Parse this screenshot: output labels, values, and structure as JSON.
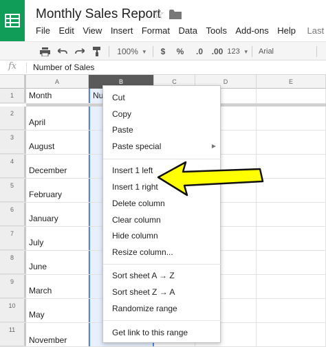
{
  "doc": {
    "title": "Monthly Sales Report"
  },
  "menu": {
    "items": [
      "File",
      "Edit",
      "View",
      "Insert",
      "Format",
      "Data",
      "Tools",
      "Add-ons",
      "Help"
    ],
    "last_edit": "Last edit"
  },
  "toolbar": {
    "zoom": "100%",
    "currency": "$",
    "percent": "%",
    "decrease_decimals": ".0",
    "increase_decimals": ".00",
    "more_formats": "123",
    "font": "Arial"
  },
  "formula_bar": {
    "fx": "fx",
    "value": "Number of Sales"
  },
  "columns": [
    "A",
    "B",
    "C",
    "D",
    "E"
  ],
  "rows": [
    {
      "num": "1",
      "a": "Month",
      "b": "Nu"
    },
    {
      "num": "2",
      "a": "April",
      "b": ""
    },
    {
      "num": "3",
      "a": "August",
      "b": ""
    },
    {
      "num": "4",
      "a": "December",
      "b": ""
    },
    {
      "num": "5",
      "a": "February",
      "b": ""
    },
    {
      "num": "6",
      "a": "January",
      "b": ""
    },
    {
      "num": "7",
      "a": "July",
      "b": ""
    },
    {
      "num": "8",
      "a": "June",
      "b": ""
    },
    {
      "num": "9",
      "a": "March",
      "b": ""
    },
    {
      "num": "10",
      "a": "May",
      "b": ""
    },
    {
      "num": "11",
      "a": "November",
      "b": ""
    }
  ],
  "context_menu": {
    "cut": "Cut",
    "copy": "Copy",
    "paste": "Paste",
    "paste_special": "Paste special",
    "insert_left": "Insert 1 left",
    "insert_right": "Insert 1 right",
    "delete_column": "Delete column",
    "clear_column": "Clear column",
    "hide_column": "Hide column",
    "resize_column": "Resize column...",
    "sort_az": "Sort sheet A → Z",
    "sort_za": "Sort sheet Z → A",
    "randomize": "Randomize range",
    "get_link": "Get link to this range"
  },
  "colors": {
    "sheets_green": "#0f9d58",
    "selection_blue": "#4f86ec",
    "arrow_yellow": "#ffff00"
  }
}
